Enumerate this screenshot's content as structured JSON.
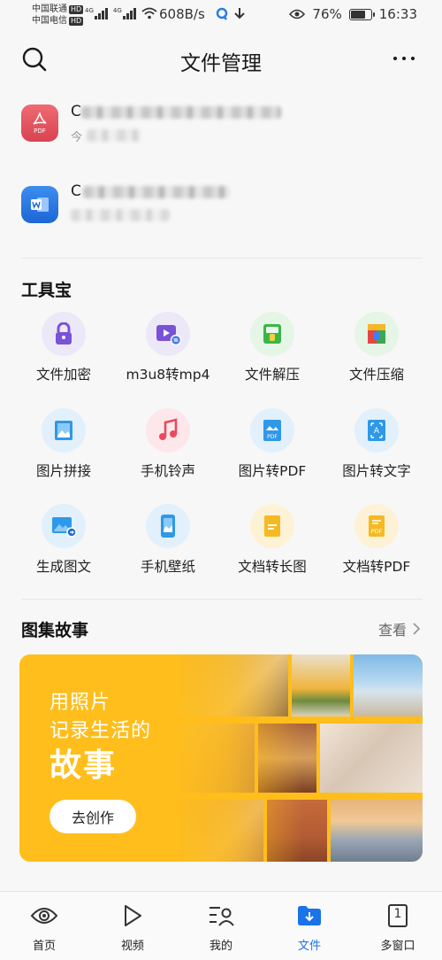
{
  "status_bar": {
    "carrier1": "中国联通",
    "carrier2": "中国电信",
    "hd": "HD",
    "net": "4G",
    "speed": "608B/s",
    "battery": "76%",
    "battery_level": 0.76,
    "time": "16:33"
  },
  "header": {
    "title": "文件管理"
  },
  "recent_files": [
    {
      "type": "pdf",
      "icon_label": "PDF",
      "name_first_char": "C",
      "meta_first_char": "今"
    },
    {
      "type": "word",
      "icon_label": "W",
      "name_first_char": "C",
      "meta_first_char": ""
    }
  ],
  "toolbox": {
    "title": "工具宝",
    "tools": [
      {
        "label": "文件加密",
        "icon": "lock-icon"
      },
      {
        "label": "m3u8转mp4",
        "icon": "video-convert-icon"
      },
      {
        "label": "文件解压",
        "icon": "unzip-icon"
      },
      {
        "label": "文件压缩",
        "icon": "zip-icon"
      },
      {
        "label": "图片拼接",
        "icon": "image-stitch-icon"
      },
      {
        "label": "手机铃声",
        "icon": "music-note-icon"
      },
      {
        "label": "图片转PDF",
        "icon": "image-to-pdf-icon"
      },
      {
        "label": "图片转文字",
        "icon": "image-to-text-icon"
      },
      {
        "label": "生成图文",
        "icon": "image-text-icon"
      },
      {
        "label": "手机壁纸",
        "icon": "wallpaper-icon"
      },
      {
        "label": "文档转长图",
        "icon": "doc-to-long-image-icon"
      },
      {
        "label": "文档转PDF",
        "icon": "doc-to-pdf-icon"
      }
    ]
  },
  "gallery": {
    "title": "图集故事",
    "see_more": "查看",
    "banner_line1": "用照片",
    "banner_line2": "记录生活的",
    "banner_line3": "故事",
    "cta": "去创作"
  },
  "bottom_nav": {
    "items": [
      {
        "label": "首页",
        "icon": "eye-icon"
      },
      {
        "label": "视频",
        "icon": "play-icon"
      },
      {
        "label": "我的",
        "icon": "profile-list-icon"
      },
      {
        "label": "文件",
        "icon": "folder-download-icon",
        "active": true
      },
      {
        "label": "多窗口",
        "icon": "multi-window-icon",
        "badge": "1"
      }
    ]
  },
  "colors": {
    "accent": "#1a73e8",
    "banner": "#ffbe1c",
    "background": "#f7f7f7"
  }
}
